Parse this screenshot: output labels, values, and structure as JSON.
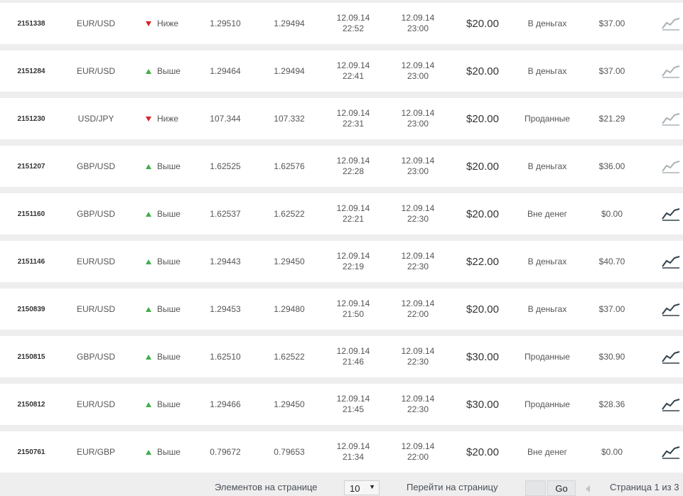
{
  "trades": [
    {
      "id": "2151338",
      "pair": "EUR/USD",
      "direction": "Ниже",
      "dir": "down",
      "open_price": "1.29510",
      "close_price": "1.29494",
      "open_date": "12.09.14",
      "open_time": "22:52",
      "expiry_date": "12.09.14",
      "expiry_time": "23:00",
      "amount": "$20.00",
      "status": "В деньгах",
      "payout": "$37.00",
      "chart_icon": "disabled"
    },
    {
      "id": "2151284",
      "pair": "EUR/USD",
      "direction": "Выше",
      "dir": "up",
      "open_price": "1.29464",
      "close_price": "1.29494",
      "open_date": "12.09.14",
      "open_time": "22:41",
      "expiry_date": "12.09.14",
      "expiry_time": "23:00",
      "amount": "$20.00",
      "status": "В деньгах",
      "payout": "$37.00",
      "chart_icon": "disabled"
    },
    {
      "id": "2151230",
      "pair": "USD/JPY",
      "direction": "Ниже",
      "dir": "down",
      "open_price": "107.344",
      "close_price": "107.332",
      "open_date": "12.09.14",
      "open_time": "22:31",
      "expiry_date": "12.09.14",
      "expiry_time": "23:00",
      "amount": "$20.00",
      "status": "Проданные",
      "payout": "$21.29",
      "chart_icon": "disabled"
    },
    {
      "id": "2151207",
      "pair": "GBP/USD",
      "direction": "Выше",
      "dir": "up",
      "open_price": "1.62525",
      "close_price": "1.62576",
      "open_date": "12.09.14",
      "open_time": "22:28",
      "expiry_date": "12.09.14",
      "expiry_time": "23:00",
      "amount": "$20.00",
      "status": "В деньгах",
      "payout": "$36.00",
      "chart_icon": "disabled"
    },
    {
      "id": "2151160",
      "pair": "GBP/USD",
      "direction": "Выше",
      "dir": "up",
      "open_price": "1.62537",
      "close_price": "1.62522",
      "open_date": "12.09.14",
      "open_time": "22:21",
      "expiry_date": "12.09.14",
      "expiry_time": "22:30",
      "amount": "$20.00",
      "status": "Вне денег",
      "payout": "$0.00",
      "chart_icon": "enabled"
    },
    {
      "id": "2151146",
      "pair": "EUR/USD",
      "direction": "Выше",
      "dir": "up",
      "open_price": "1.29443",
      "close_price": "1.29450",
      "open_date": "12.09.14",
      "open_time": "22:19",
      "expiry_date": "12.09.14",
      "expiry_time": "22:30",
      "amount": "$22.00",
      "status": "В деньгах",
      "payout": "$40.70",
      "chart_icon": "enabled"
    },
    {
      "id": "2150839",
      "pair": "EUR/USD",
      "direction": "Выше",
      "dir": "up",
      "open_price": "1.29453",
      "close_price": "1.29480",
      "open_date": "12.09.14",
      "open_time": "21:50",
      "expiry_date": "12.09.14",
      "expiry_time": "22:00",
      "amount": "$20.00",
      "status": "В деньгах",
      "payout": "$37.00",
      "chart_icon": "enabled"
    },
    {
      "id": "2150815",
      "pair": "GBP/USD",
      "direction": "Выше",
      "dir": "up",
      "open_price": "1.62510",
      "close_price": "1.62522",
      "open_date": "12.09.14",
      "open_time": "21:46",
      "expiry_date": "12.09.14",
      "expiry_time": "22:30",
      "amount": "$30.00",
      "status": "Проданные",
      "payout": "$30.90",
      "chart_icon": "enabled"
    },
    {
      "id": "2150812",
      "pair": "EUR/USD",
      "direction": "Выше",
      "dir": "up",
      "open_price": "1.29466",
      "close_price": "1.29450",
      "open_date": "12.09.14",
      "open_time": "21:45",
      "expiry_date": "12.09.14",
      "expiry_time": "22:30",
      "amount": "$30.00",
      "status": "Проданные",
      "payout": "$28.36",
      "chart_icon": "enabled"
    },
    {
      "id": "2150761",
      "pair": "EUR/GBP",
      "direction": "Выше",
      "dir": "up",
      "open_price": "0.79672",
      "close_price": "0.79653",
      "open_date": "12.09.14",
      "open_time": "21:34",
      "expiry_date": "12.09.14",
      "expiry_time": "22:00",
      "amount": "$20.00",
      "status": "Вне денег",
      "payout": "$0.00",
      "chart_icon": "enabled"
    }
  ],
  "pagination": {
    "per_page_label": "Элементов на странице",
    "per_page_value": "10",
    "goto_label": "Перейти на страницу",
    "goto_value": "",
    "go_label": "Go",
    "page_info": "Страница 1 из 3"
  },
  "colors": {
    "up_arrow": "#3fae49",
    "down_arrow": "#d9232a",
    "row_background": "#ffffff",
    "page_background": "#eeeeee"
  }
}
